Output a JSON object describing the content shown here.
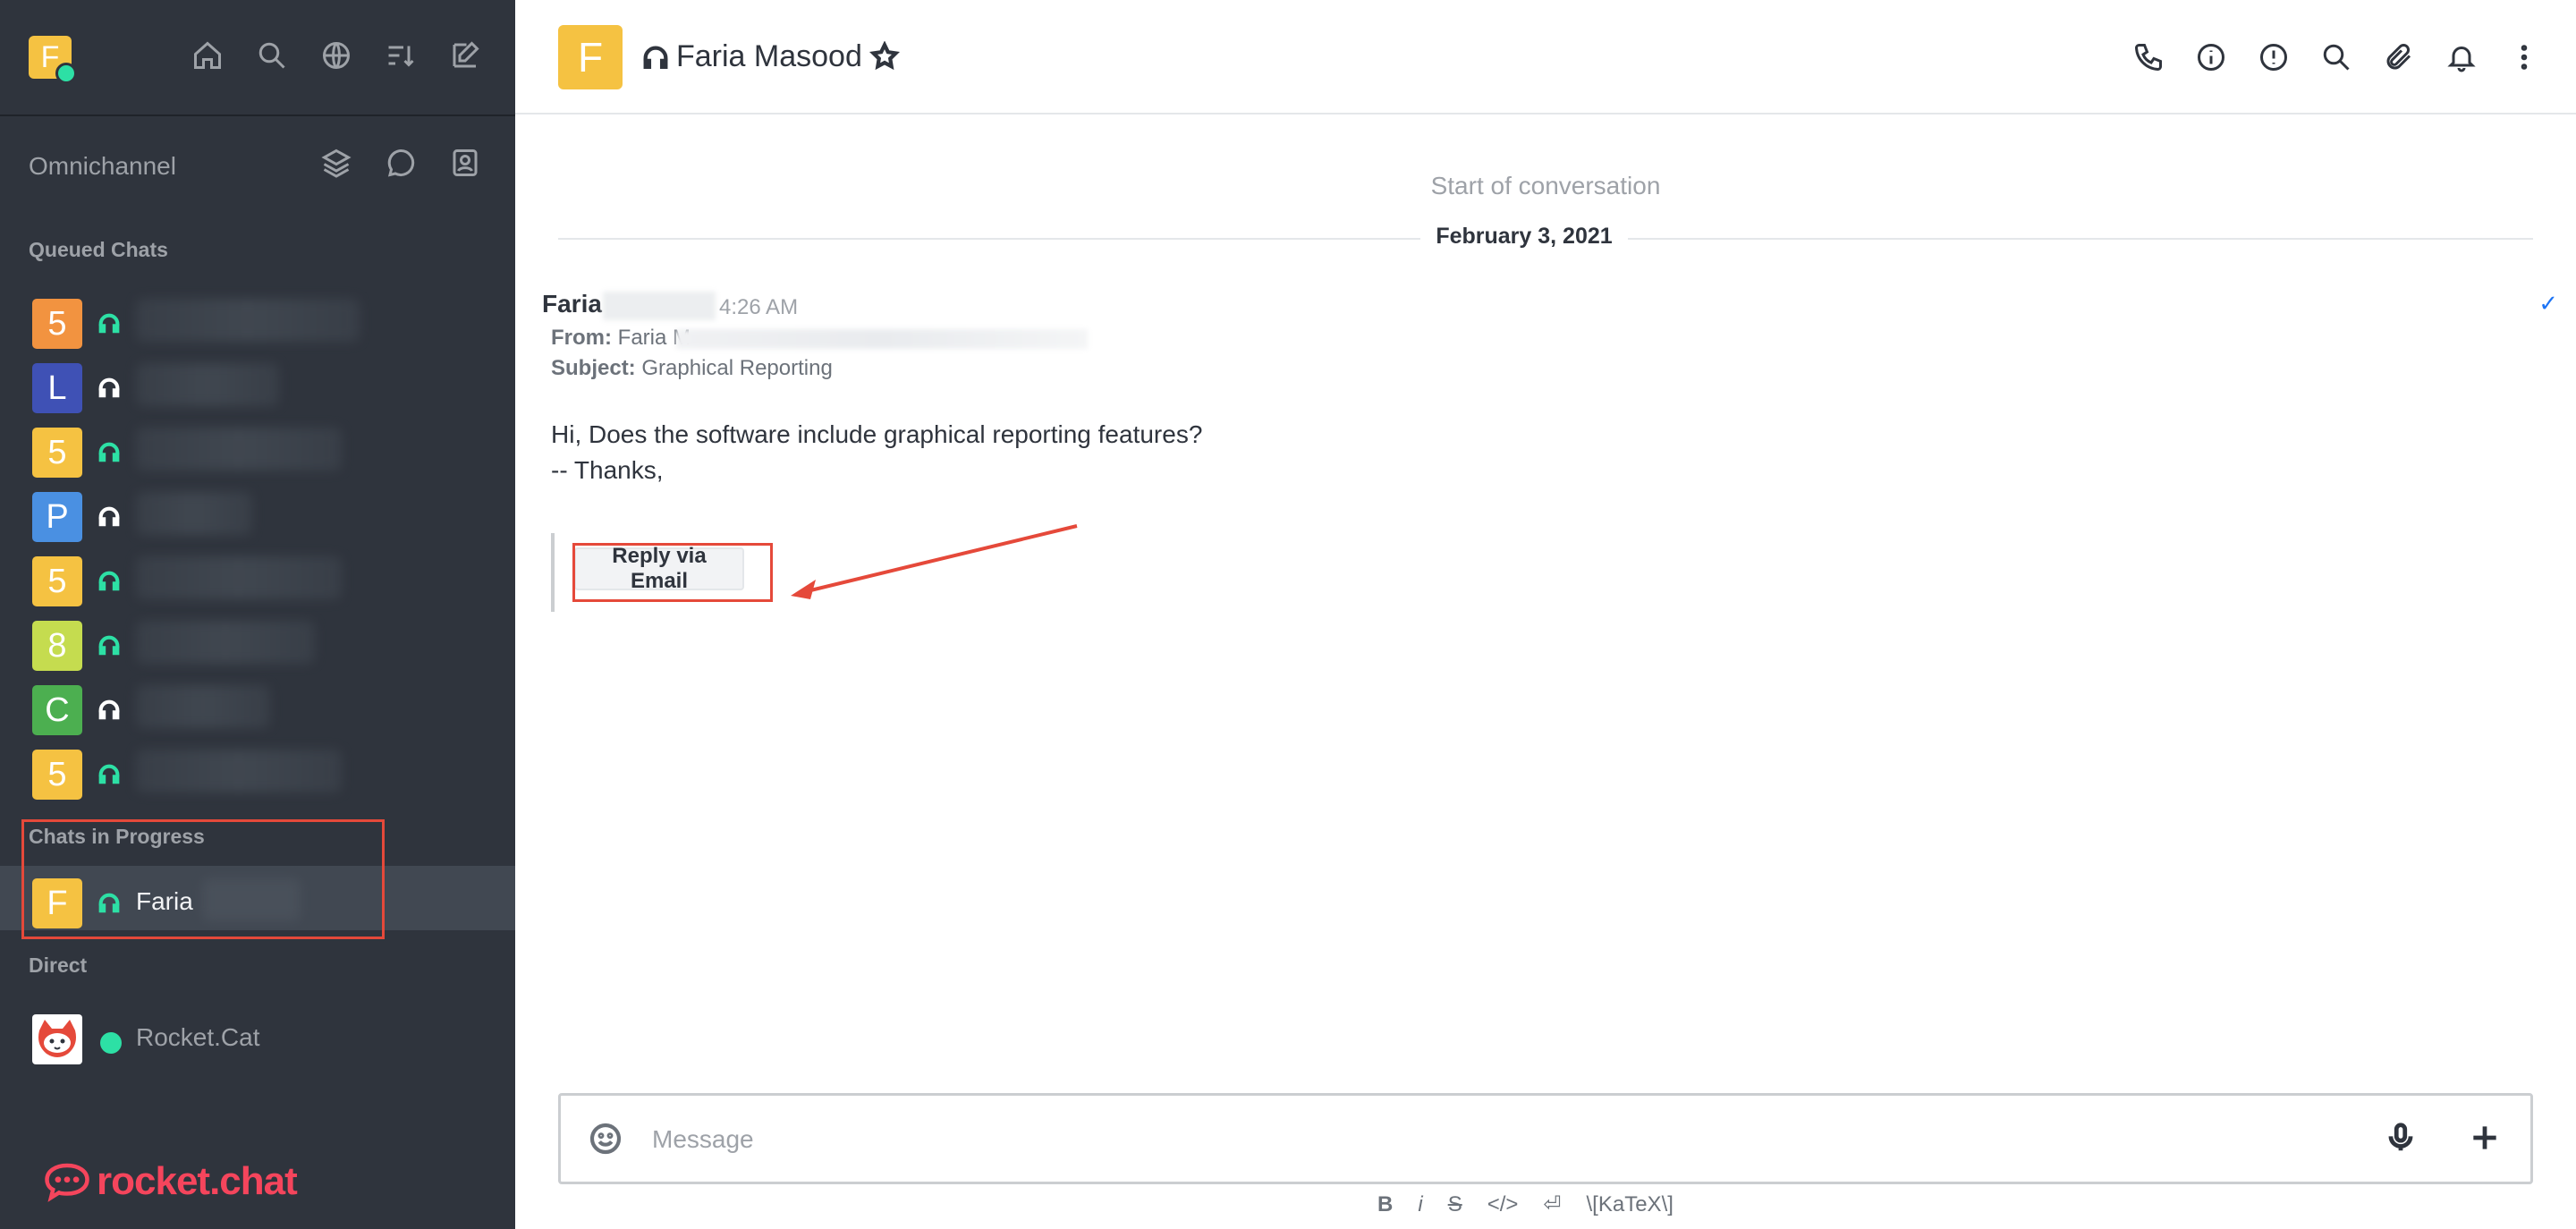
{
  "sidebar": {
    "user_avatar_letter": "F",
    "omnichannel_title": "Omnichannel",
    "queued_title": "Queued Chats",
    "queued": [
      {
        "letter": "5",
        "color": "#f29340",
        "status_color": "#2de0a5"
      },
      {
        "letter": "L",
        "color": "#3f51b5",
        "status_color": "#ffffff"
      },
      {
        "letter": "5",
        "color": "#f5c242",
        "status_color": "#2de0a5"
      },
      {
        "letter": "P",
        "color": "#4a90e2",
        "status_color": "#ffffff"
      },
      {
        "letter": "5",
        "color": "#f5c242",
        "status_color": "#2de0a5"
      },
      {
        "letter": "8",
        "color": "#c5dc4f",
        "status_color": "#2de0a5"
      },
      {
        "letter": "C",
        "color": "#4caf50",
        "status_color": "#ffffff"
      },
      {
        "letter": "5",
        "color": "#f5c242",
        "status_color": "#2de0a5"
      }
    ],
    "in_progress_title": "Chats in Progress",
    "in_progress": [
      {
        "letter": "F",
        "name": "Faria",
        "color": "#f5c242"
      }
    ],
    "direct_title": "Direct",
    "direct": [
      {
        "name": "Rocket.Cat"
      }
    ],
    "brand": "rocket.chat"
  },
  "header": {
    "avatar_letter": "F",
    "title": "Faria Masood"
  },
  "messages": {
    "start_label": "Start of conversation",
    "date": "February 3, 2021",
    "author": "Faria",
    "time": "4:26 AM",
    "from_label": "From:",
    "from_value": "Faria M",
    "subject_label": "Subject:",
    "subject_value": "Graphical Reporting",
    "body_line1": "Hi, Does the software include graphical reporting features?",
    "body_line2": "-- Thanks,",
    "reply_button": "Reply via Email"
  },
  "composer": {
    "placeholder": "Message",
    "format": {
      "bold": "B",
      "italic": "i",
      "strike": "S",
      "code": "</>",
      "katex": "\\[KaTeX\\]"
    }
  },
  "colors": {
    "accent_red": "#e5493a",
    "online": "#2de0a5",
    "sidebar_bg": "#2f343d"
  }
}
